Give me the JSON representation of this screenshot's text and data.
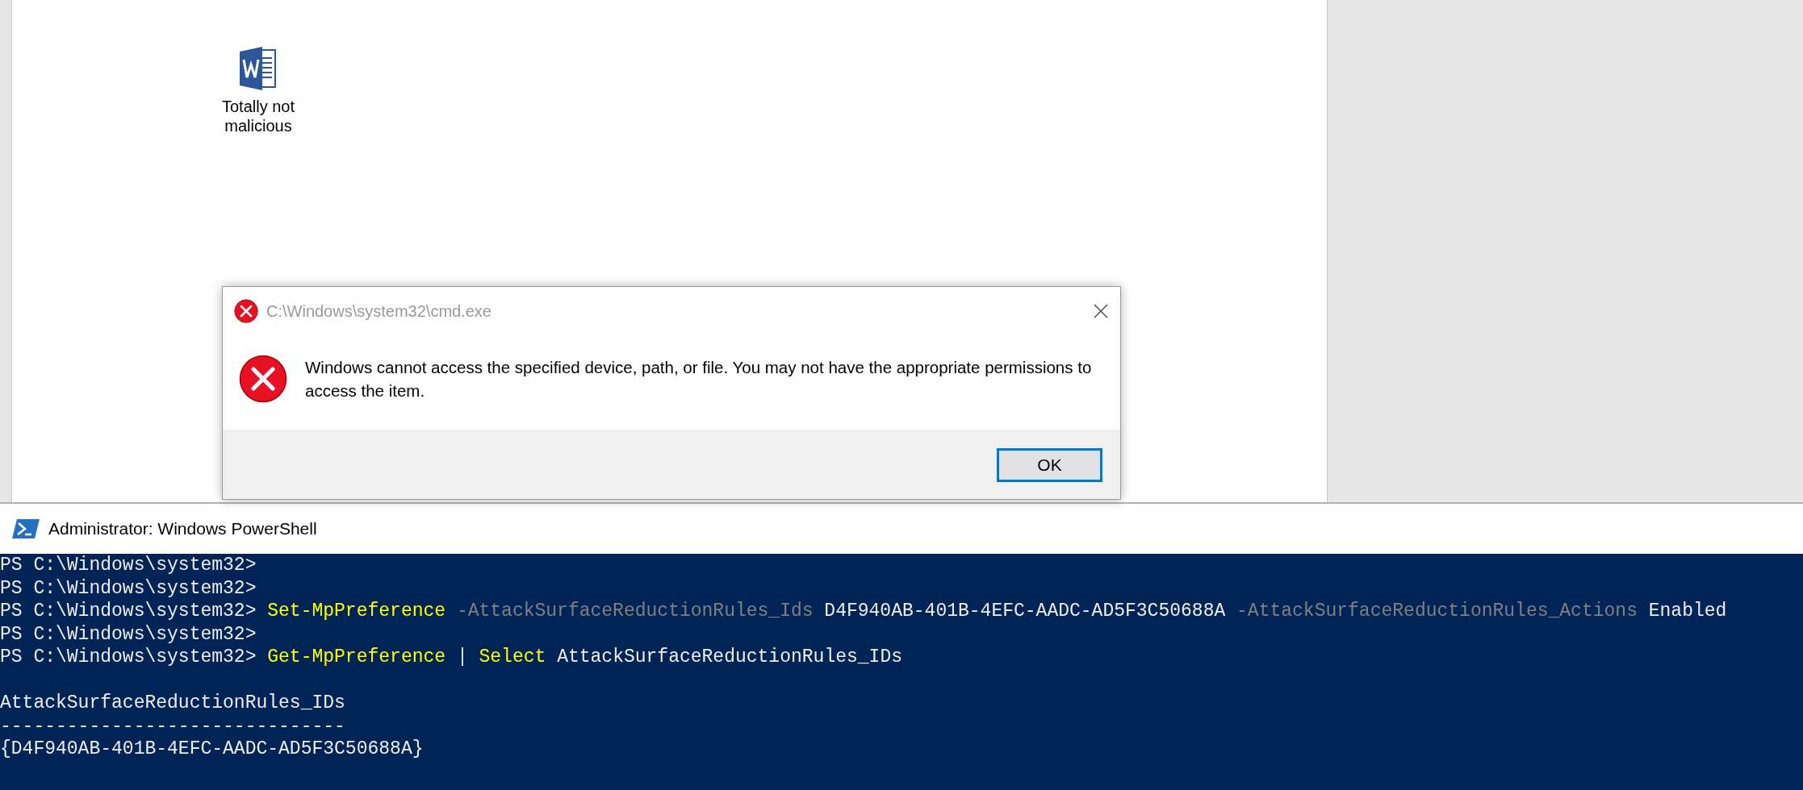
{
  "desktop": {
    "icons": [
      {
        "label": "Totally not malicious"
      }
    ]
  },
  "dialog": {
    "title": "C:\\Windows\\system32\\cmd.exe",
    "message": "Windows cannot access the specified device, path, or file. You may not have the appropriate permissions to access the item.",
    "buttons": [
      {
        "label": "OK",
        "selected": true
      }
    ]
  },
  "powershell": {
    "title": "Administrator: Windows PowerShell",
    "lines": [
      {
        "kind": "code",
        "segments": [
          {
            "kind": "prompt",
            "text": "PS C:\\Windows\\system32>"
          }
        ]
      },
      {
        "kind": "code",
        "segments": [
          {
            "kind": "prompt",
            "text": "PS C:\\Windows\\system32>"
          }
        ]
      },
      {
        "kind": "code",
        "segments": [
          {
            "kind": "prompt",
            "text": "PS C:\\Windows\\system32>"
          },
          {
            "kind": "command",
            "text": "Set-MpPreference"
          },
          {
            "kind": "parameter",
            "text": "-AttackSurfaceReductionRules_Ids"
          },
          {
            "kind": "argument",
            "text": "D4F940AB-401B-4EFC-AADC-AD5F3C50688A"
          },
          {
            "kind": "parameter",
            "text": "-AttackSurfaceReductionRules_Actions"
          },
          {
            "kind": "argument",
            "text": "Enabled"
          }
        ]
      },
      {
        "kind": "code",
        "segments": [
          {
            "kind": "prompt",
            "text": "PS C:\\Windows\\system32>"
          }
        ]
      },
      {
        "kind": "code",
        "segments": [
          {
            "kind": "prompt",
            "text": "PS C:\\Windows\\system32>"
          },
          {
            "kind": "command",
            "text": "Get-MpPreference"
          },
          {
            "kind": "argument",
            "text": "|"
          },
          {
            "kind": "command",
            "text": "Select"
          },
          {
            "kind": "argument",
            "text": "AttackSurfaceReductionRules_IDs"
          }
        ]
      },
      {
        "kind": "blank"
      },
      {
        "kind": "code",
        "segments": [
          {
            "kind": "output",
            "text": "AttackSurfaceReductionRules_IDs"
          }
        ]
      },
      {
        "kind": "code",
        "segments": [
          {
            "kind": "output",
            "text": "-------------------------------"
          }
        ]
      },
      {
        "kind": "code",
        "segments": [
          {
            "kind": "output",
            "text": "{D4F940AB-401B-4EFC-AADC-AD5F3C50688A}"
          }
        ]
      }
    ]
  }
}
